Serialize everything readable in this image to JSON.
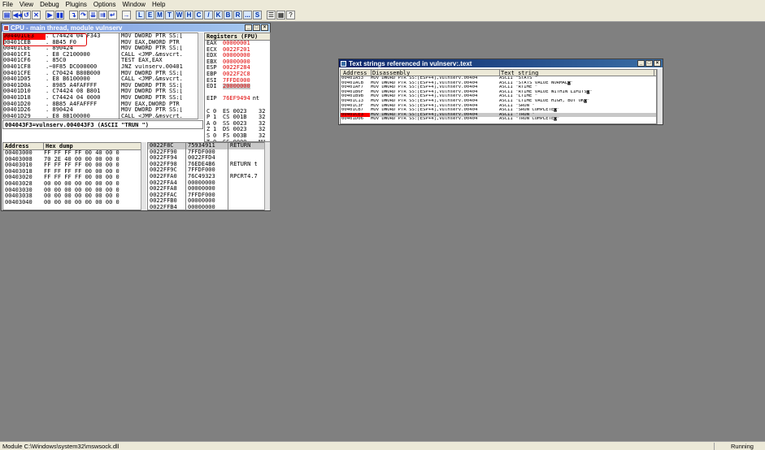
{
  "menu": [
    "File",
    "View",
    "Debug",
    "Plugins",
    "Options",
    "Window",
    "Help"
  ],
  "toolbar": {
    "buttons": [
      "open-icon",
      "rewind-icon",
      "restart-icon",
      "close-icon",
      "run-icon",
      "pause-icon",
      "step-into-icon",
      "step-over-icon",
      "trace-into-icon",
      "trace-over-icon",
      "execute-till-return-icon",
      "goto-icon"
    ],
    "letters": [
      "L",
      "E",
      "M",
      "T",
      "W",
      "H",
      "C",
      "/",
      "K",
      "B",
      "R",
      "...",
      "S"
    ]
  },
  "cpu_window": {
    "title": "CPU - main thread, module vulnserv",
    "disasm_rows": [
      {
        "addr": "004401CE3",
        "hex": ". C74424 04 F343",
        "instr": "MOV DWORD PTR SS:["
      },
      {
        "addr": "00401CEB",
        "hex": ". 8B45 F0",
        "instr": "MOV EAX,DWORD PTR"
      },
      {
        "addr": "00401CEE",
        "hex": ". 890424",
        "instr": "MOV DWORD PTR SS:["
      },
      {
        "addr": "00401CF1",
        "hex": ". E8 C2100000",
        "instr": "CALL <JMP.&msvcrt."
      },
      {
        "addr": "00401CF6",
        "hex": ". 85C0",
        "instr": "TEST EAX,EAX"
      },
      {
        "addr": "00401CF8",
        "hex": ".~0F85 DC000000",
        "instr": "JNZ vulnserv.00401"
      },
      {
        "addr": "00401CFE",
        "hex": ". C70424 B80B000",
        "instr": "MOV DWORD PTR SS:["
      },
      {
        "addr": "00401D05",
        "hex": ". E8 B6100000",
        "instr": "CALL <JMP.&msvcrt."
      },
      {
        "addr": "00401D0A",
        "hex": ". 8985 A4FAFFFF",
        "instr": "MOV DWORD PTR SS:["
      },
      {
        "addr": "00401D10",
        "hex": ". C74424 08 B801",
        "instr": "MOV DWORD PTR SS:["
      },
      {
        "addr": "00401D18",
        "hex": ". C74424 04 0000",
        "instr": "MOV DWORD PTR SS:["
      },
      {
        "addr": "00401D20",
        "hex": ". 8B85 A4FAFFFF",
        "instr": "MOV EAX,DWORD PTR"
      },
      {
        "addr": "00401D26",
        "hex": ". 890424",
        "instr": "MOV DWORD PTR SS:["
      },
      {
        "addr": "00401D29",
        "hex": ". E8 8B100000",
        "instr": "CALL <JMP.&msvcrt."
      }
    ],
    "info_line": "004043F3=vulnserv.004043F3 (ASCII \"TRUN \")",
    "registers_title": "Registers (FPU)",
    "registers": [
      {
        "name": "EAX",
        "value": "00000001",
        "changed": true
      },
      {
        "name": "ECX",
        "value": "0022F201",
        "changed": true
      },
      {
        "name": "EDX",
        "value": "00000000",
        "changed": true
      },
      {
        "name": "EBX",
        "value": "00000000",
        "changed": true
      },
      {
        "name": "ESP",
        "value": "0022F284",
        "changed": true
      },
      {
        "name": "EBP",
        "value": "0022F2C8",
        "changed": true
      },
      {
        "name": "ESI",
        "value": "7FFDE000",
        "changed": true
      },
      {
        "name": "EDI",
        "value": "20000000",
        "changed": true
      }
    ],
    "eip": {
      "name": "EIP",
      "value": "76EF9494",
      "extra": "nt"
    },
    "flags": [
      {
        "f": "C",
        "v": "0",
        "seg": "ES 0023",
        "bits": "32"
      },
      {
        "f": "P",
        "v": "1",
        "seg": "CS 001B",
        "bits": "32"
      },
      {
        "f": "A",
        "v": "0",
        "seg": "SS 0023",
        "bits": "32"
      },
      {
        "f": "Z",
        "v": "1",
        "seg": "DS 0023",
        "bits": "32"
      },
      {
        "f": "S",
        "v": "0",
        "seg": "FS 003B",
        "bits": "32"
      },
      {
        "f": "T",
        "v": "0",
        "seg": "GS 0000",
        "bits": "NU"
      }
    ],
    "dump_headers": [
      "Address",
      "Hex dump"
    ],
    "dump_rows": [
      {
        "addr": "00403000",
        "hex": "FF FF FF FF 00 40 00 0"
      },
      {
        "addr": "00403008",
        "hex": "70 2E 40 00 00 00 00 0"
      },
      {
        "addr": "00403010",
        "hex": "FF FF FF FF 00 00 00 0"
      },
      {
        "addr": "00403018",
        "hex": "FF FF FF FF 00 00 00 0"
      },
      {
        "addr": "00403020",
        "hex": "FF FF FF FF 00 00 00 0"
      },
      {
        "addr": "00403028",
        "hex": "00 00 00 00 00 00 00 0"
      },
      {
        "addr": "00403030",
        "hex": "00 00 00 00 00 00 00 0"
      },
      {
        "addr": "00403038",
        "hex": "00 00 00 00 00 00 00 0"
      },
      {
        "addr": "00403040",
        "hex": "00 00 00 00 00 00 00 0"
      }
    ],
    "stack_rows": [
      {
        "addr": "0022F8C",
        "val": "75934911",
        "cmt": "RETURN"
      },
      {
        "addr": "0022FF90",
        "val": "7FFDF000",
        "cmt": ""
      },
      {
        "addr": "0022FF94",
        "val": "0022FFD4",
        "cmt": ""
      },
      {
        "addr": "0022FF98",
        "val": "76EDE4B6",
        "cmt": "RETURN t"
      },
      {
        "addr": "0022FF9C",
        "val": "7FFDF000",
        "cmt": ""
      },
      {
        "addr": "0022FFA0",
        "val": "76C49323",
        "cmt": "RPCRT4.7"
      },
      {
        "addr": "0022FFA4",
        "val": "00000000",
        "cmt": ""
      },
      {
        "addr": "0022FFA8",
        "val": "00000000",
        "cmt": ""
      },
      {
        "addr": "0022FFAC",
        "val": "7FFDF000",
        "cmt": ""
      },
      {
        "addr": "0022FFB0",
        "val": "00000000",
        "cmt": ""
      },
      {
        "addr": "0022FFB4",
        "val": "00000000",
        "cmt": ""
      }
    ]
  },
  "strings_window": {
    "title": "Text strings referenced in vulnserv:.text",
    "headers": [
      "Address",
      "Disassembly",
      "Text string"
    ],
    "rows": [
      {
        "addr": "00401A53",
        "dis": "MOV DWORD PTR SS:[ESP+4],vulnserv.00404",
        "txt": "ASCII \"STATS \"",
        "hl": false
      },
      {
        "addr": "00401ACB",
        "dis": "MOV DWORD PTR SS:[ESP+4],vulnserv.00404",
        "txt": "ASCII \"STATS VALUE NORMAL◙\"",
        "hl": false
      },
      {
        "addr": "00401AF7",
        "dis": "MOV DWORD PTR SS:[ESP+4],vulnserv.00404",
        "txt": "ASCII \"RTIME \"",
        "hl": false
      },
      {
        "addr": "00401B6F",
        "dis": "MOV DWORD PTR SS:[ESP+4],vulnserv.00404",
        "txt": "ASCII \"RTIME VALUE WITHIN LIMITS◙\"",
        "hl": false
      },
      {
        "addr": "00401B9B",
        "dis": "MOV DWORD PTR SS:[ESP+4],vulnserv.00404",
        "txt": "ASCII \"LTIME \"",
        "hl": false
      },
      {
        "addr": "00401C13",
        "dis": "MOV DWORD PTR SS:[ESP+4],vulnserv.00404",
        "txt": "ASCII \"LTIME VALUE HIGH, BUT OK◙\"",
        "hl": false
      },
      {
        "addr": "00401C3F",
        "dis": "MOV DWORD PTR SS:[ESP+4],vulnserv.00404",
        "txt": "ASCII \"SRUN \"",
        "hl": false
      },
      {
        "addr": "00401CB7",
        "dis": "MOV DWORD PTR SS:[ESP+4],vulnserv.00404",
        "txt": "ASCII \"SRUN COMPLETE◙\"",
        "hl": false
      },
      {
        "addr": "00401CE3",
        "dis": "MOV DWORD PTR SS:[ESP+4],vulnserv.00404",
        "txt": "ASCII \"TRUN \"",
        "hl": true
      },
      {
        "addr": "00401D06",
        "dis": "MOV DWORD PTR SS:[ESP+4],vulnserv.00404",
        "txt": "ASCII \"TRUN COMPLETE◙\"",
        "hl": false
      }
    ]
  },
  "status": {
    "left": "Module C:\\Windows\\system32\\mswsock.dll",
    "right": "Running"
  },
  "colors": {
    "highlight": "#ff0000",
    "changed_reg": "#e00000",
    "title_active": "#0a246a"
  }
}
